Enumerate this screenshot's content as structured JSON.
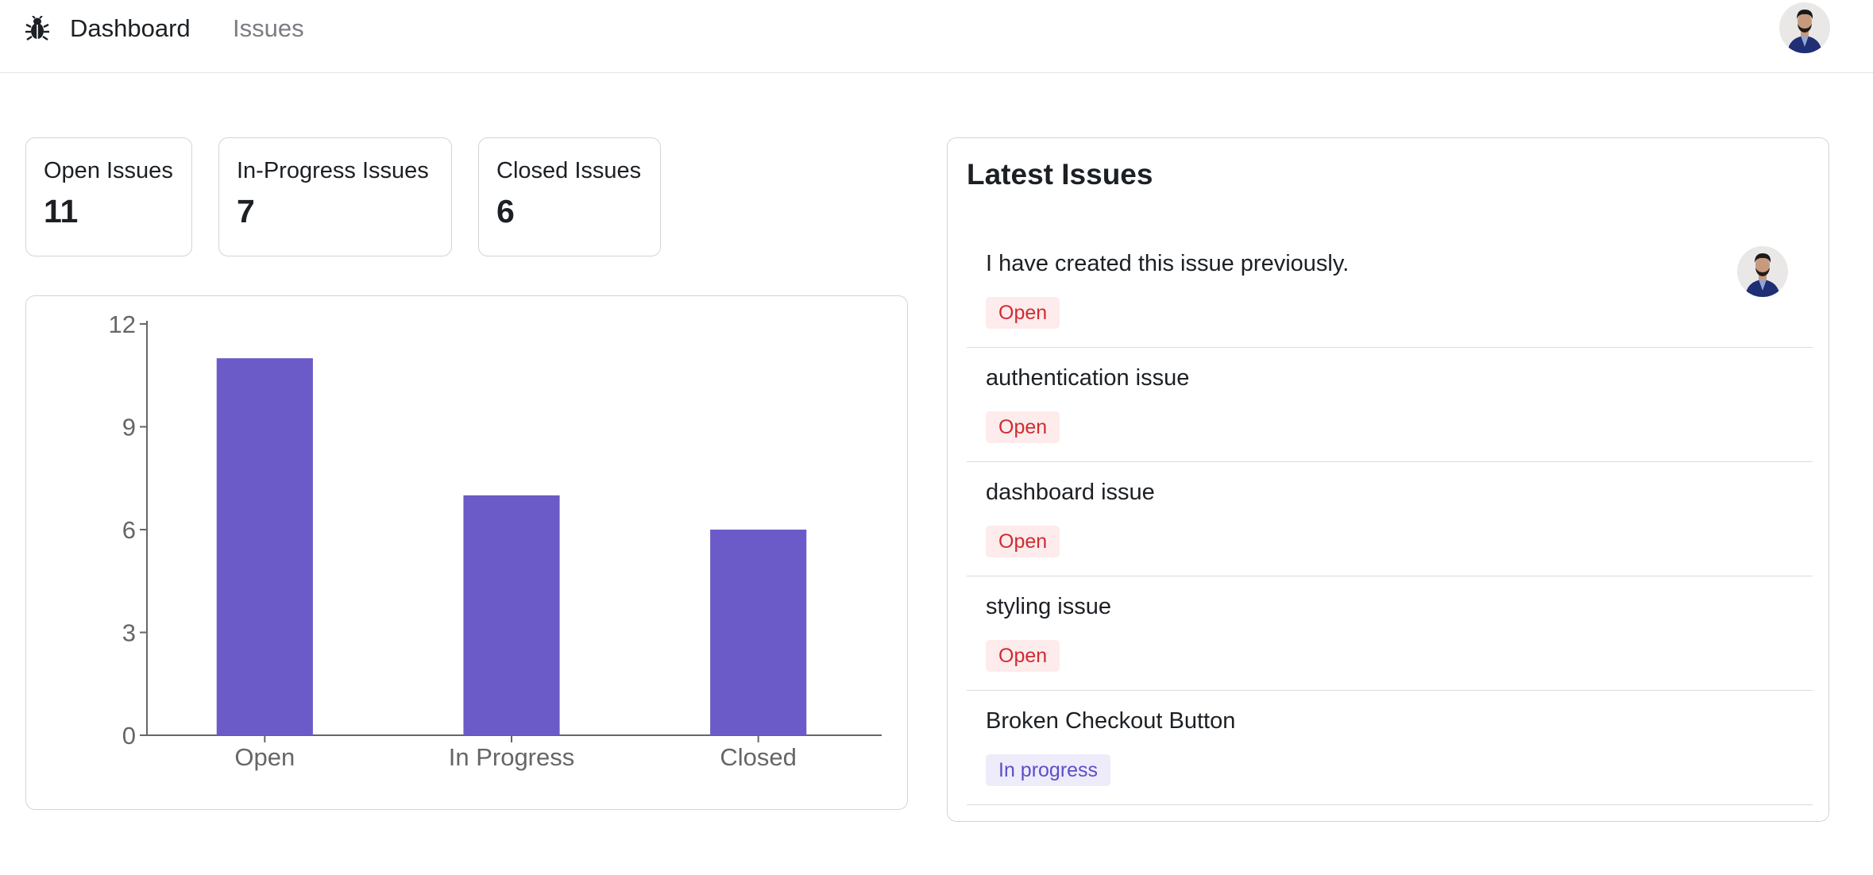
{
  "nav": {
    "logo_icon": "bug-icon",
    "links": [
      {
        "label": "Dashboard",
        "active": true
      },
      {
        "label": "Issues",
        "active": false
      }
    ],
    "avatar_icon": "user-avatar"
  },
  "stats": [
    {
      "label": "Open Issues",
      "value": "11"
    },
    {
      "label": "In-Progress Issues",
      "value": "7"
    },
    {
      "label": "Closed Issues",
      "value": "6"
    }
  ],
  "chart_data": {
    "type": "bar",
    "categories": [
      "Open",
      "In Progress",
      "Closed"
    ],
    "values": [
      11,
      7,
      6
    ],
    "yticks": [
      0,
      3,
      6,
      9,
      12
    ],
    "ylim": [
      0,
      12
    ],
    "title": "",
    "xlabel": "",
    "ylabel": "",
    "bar_color": "#6b5bc8",
    "grid": false
  },
  "latest": {
    "title": "Latest Issues",
    "issues": [
      {
        "title": "I have created this issue previously.",
        "status": "Open",
        "status_type": "open",
        "assignee_avatar": true
      },
      {
        "title": "authentication issue",
        "status": "Open",
        "status_type": "open",
        "assignee_avatar": false
      },
      {
        "title": "dashboard issue",
        "status": "Open",
        "status_type": "open",
        "assignee_avatar": false
      },
      {
        "title": "styling issue",
        "status": "Open",
        "status_type": "open",
        "assignee_avatar": false
      },
      {
        "title": "Broken Checkout Button",
        "status": "In progress",
        "status_type": "progress",
        "assignee_avatar": false
      }
    ]
  },
  "colors": {
    "accent": "#6b5bc8",
    "open_badge_bg": "#feebec",
    "open_badge_text": "#ce2c31",
    "progress_badge_bg": "#eeebfb",
    "progress_badge_text": "#5b4fc7"
  }
}
